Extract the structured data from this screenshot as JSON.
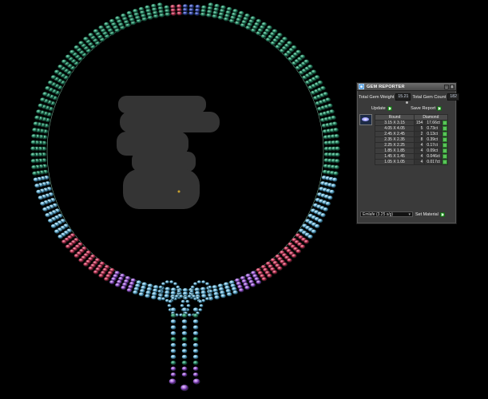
{
  "panel": {
    "title": "GEM REPORTER",
    "app_icon": "gem-reporter-app-icon",
    "window_buttons": [
      "_",
      "x"
    ],
    "total_weight_label": "Total Gem Weight",
    "total_weight_value": "15.21",
    "total_count_label": "Total Gem Count",
    "total_count_value": "182",
    "update_label": "Update",
    "save_report_label": "Save Report",
    "columns": [
      "Round",
      "Diamond"
    ],
    "rows": [
      {
        "size": "3.15 X 3.15",
        "count": "154",
        "weight": "17.66ct"
      },
      {
        "size": "4.05 X 4.05",
        "count": "5",
        "weight": "0.73ct"
      },
      {
        "size": "2.45 X 2.45",
        "count": "2",
        "weight": "0.13ct"
      },
      {
        "size": "2.35 X 2.35",
        "count": "8",
        "weight": "0.39ct"
      },
      {
        "size": "2.25 X 2.25",
        "count": "4",
        "weight": "0.17ct"
      },
      {
        "size": "1.85 X 1.85",
        "count": "4",
        "weight": "0.09ct"
      },
      {
        "size": "1.45 X 1.45",
        "count": "4",
        "weight": "0.046ct"
      },
      {
        "size": "1.05 X 1.05",
        "count": "4",
        "weight": "0.017ct"
      }
    ],
    "material_value": "Emlafe   (3.25 s/g)",
    "set_material_label": "Set Material"
  },
  "colors": {
    "gem_green": "#2f8f6c",
    "gem_blue": "#6fb6d8",
    "gem_red": "#c0395a",
    "gem_purple": "#9a5ad0",
    "panel_bg": "#3a3a3a",
    "button_green": "#3aa83a"
  }
}
